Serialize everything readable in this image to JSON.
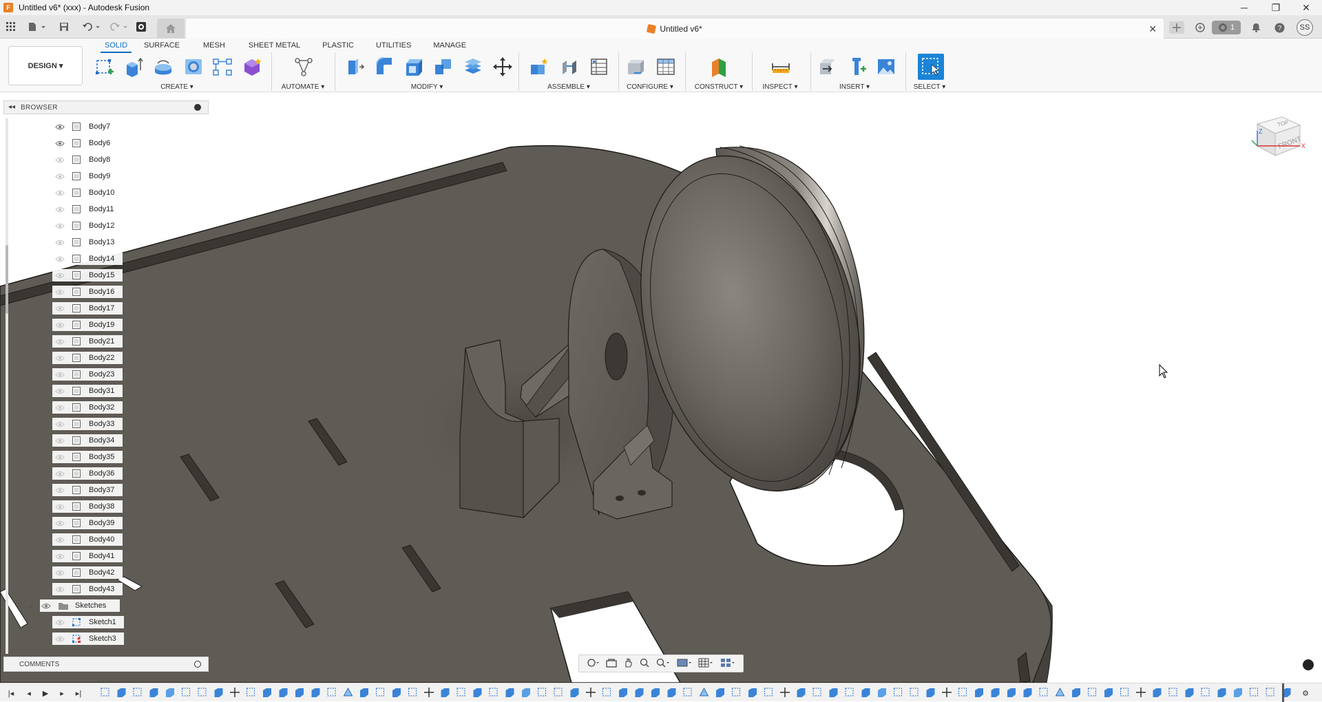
{
  "window": {
    "title": "Untitled v6* (xxx) - Autodesk Fusion",
    "controls": {
      "minimize": "─",
      "restore": "❐",
      "close": "✕"
    }
  },
  "document": {
    "tab_name": "Untitled v6*",
    "close_glyph": "✕",
    "job_count": "1",
    "user_initials": "SS"
  },
  "ribbon": {
    "workspace": "DESIGN ▾",
    "tabs": [
      "SOLID",
      "SURFACE",
      "MESH",
      "SHEET METAL",
      "PLASTIC",
      "UTILITIES",
      "MANAGE"
    ],
    "active_tab": "SOLID",
    "groups": {
      "create": "CREATE ▾",
      "automate": "AUTOMATE ▾",
      "modify": "MODIFY ▾",
      "assemble": "ASSEMBLE ▾",
      "configure": "CONFIGURE ▾",
      "construct": "CONSTRUCT ▾",
      "inspect": "INSPECT ▾",
      "insert": "INSERT ▾",
      "select": "SELECT ▾"
    }
  },
  "browser": {
    "title": "BROWSER",
    "bodies": [
      {
        "label": "Body7",
        "visible": true
      },
      {
        "label": "Body6",
        "visible": true
      },
      {
        "label": "Body8",
        "visible": false
      },
      {
        "label": "Body9",
        "visible": false
      },
      {
        "label": "Body10",
        "visible": false
      },
      {
        "label": "Body11",
        "visible": false
      },
      {
        "label": "Body12",
        "visible": false
      },
      {
        "label": "Body13",
        "visible": false
      },
      {
        "label": "Body14",
        "visible": false
      },
      {
        "label": "Body15",
        "visible": false
      },
      {
        "label": "Body16",
        "visible": false
      },
      {
        "label": "Body17",
        "visible": false
      },
      {
        "label": "Body19",
        "visible": false
      },
      {
        "label": "Body21",
        "visible": false
      },
      {
        "label": "Body22",
        "visible": false
      },
      {
        "label": "Body23",
        "visible": false
      },
      {
        "label": "Body31",
        "visible": false
      },
      {
        "label": "Body32",
        "visible": false
      },
      {
        "label": "Body33",
        "visible": false
      },
      {
        "label": "Body34",
        "visible": false
      },
      {
        "label": "Body35",
        "visible": false
      },
      {
        "label": "Body36",
        "visible": false
      },
      {
        "label": "Body37",
        "visible": false
      },
      {
        "label": "Body38",
        "visible": false
      },
      {
        "label": "Body39",
        "visible": false
      },
      {
        "label": "Body40",
        "visible": false
      },
      {
        "label": "Body41",
        "visible": false
      },
      {
        "label": "Body42",
        "visible": false
      },
      {
        "label": "Body43",
        "visible": false
      }
    ],
    "sketches_folder": "Sketches",
    "sketches": [
      {
        "label": "Sketch1"
      },
      {
        "label": "Sketch3"
      }
    ]
  },
  "comments": {
    "title": "COMMENTS"
  },
  "viewcube": {
    "top": "TOP",
    "front": "FRONT",
    "axis_x": "X",
    "axis_z": "Z"
  },
  "colors": {
    "accent": "#0a6dc2",
    "brand": "#e8822a",
    "plate": "#5f5b55",
    "wheel": "#6b6760"
  }
}
